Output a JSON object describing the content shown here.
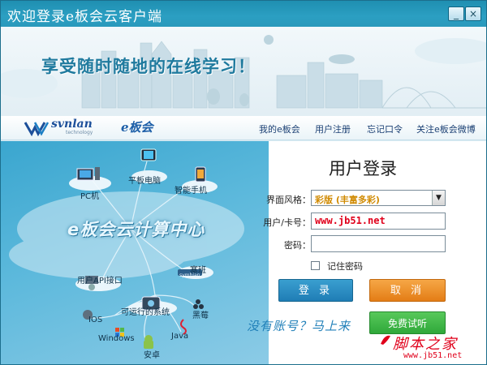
{
  "window": {
    "title": "欢迎登录e板会云客户端",
    "minimize_glyph": "_",
    "close_glyph": "×"
  },
  "banner": {
    "slogan": "享受随时随地的在线学习！"
  },
  "brand": {
    "svnlan_logo": "svnlan",
    "svnlan_sub": "technology",
    "eban_logo": "e板会"
  },
  "nav": {
    "items": [
      "我的e板会",
      "用户注册",
      "忘记口令",
      "关注e板会微博"
    ]
  },
  "illustration": {
    "center_title": "e板会云计算中心",
    "nodes": [
      "平板电脑",
      "PC机",
      "智能手机",
      "用户API接口",
      "塞班",
      "可运行的系统",
      "黑莓",
      "IOS",
      "Windows",
      "Java",
      "安卓"
    ],
    "symbian_badge": "symbian"
  },
  "login": {
    "title": "用户登录",
    "style_label": "界面风格：",
    "style_value": "彩版 (丰富多彩)",
    "user_label": "用户/卡号：",
    "user_value": "www.jb51.net",
    "password_label": "密码：",
    "password_value": "",
    "remember_label": "记住密码",
    "login_button": "登 录",
    "cancel_button": "取 消",
    "trial_button": "免费试听",
    "no_account_prompt": "没有账号？马上来"
  },
  "watermark": {
    "text": "脚本之家",
    "url": "www.jb51.net"
  },
  "colors": {
    "titlebar": "#2b9fc2",
    "login_button": "#1f7db5",
    "cancel_button": "#e37d16",
    "trial_button": "#2fa83a",
    "watermark": "#e0001b"
  }
}
